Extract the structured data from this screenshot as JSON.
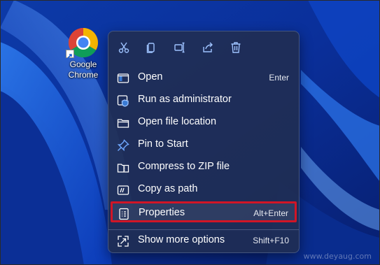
{
  "desktop": {
    "icon_label_line1": "Google",
    "icon_label_line2": "Chrome"
  },
  "toolbar": [
    {
      "name": "cut-icon"
    },
    {
      "name": "copy-icon"
    },
    {
      "name": "rename-icon"
    },
    {
      "name": "share-icon"
    },
    {
      "name": "delete-icon"
    }
  ],
  "menu": {
    "items": [
      {
        "label": "Open",
        "accelerator": "Enter",
        "icon": "open-icon"
      },
      {
        "label": "Run as administrator",
        "accelerator": "",
        "icon": "shield-icon"
      },
      {
        "label": "Open file location",
        "accelerator": "",
        "icon": "folder-icon"
      },
      {
        "label": "Pin to Start",
        "accelerator": "",
        "icon": "pin-icon"
      },
      {
        "label": "Compress to ZIP file",
        "accelerator": "",
        "icon": "zip-folder-icon"
      },
      {
        "label": "Copy as path",
        "accelerator": "",
        "icon": "copy-path-icon"
      },
      {
        "label": "Properties",
        "accelerator": "Alt+Enter",
        "icon": "properties-icon"
      },
      {
        "label": "Show more options",
        "accelerator": "Shift+F10",
        "icon": "more-options-icon"
      }
    ]
  },
  "colors": {
    "highlight_border": "#d11526",
    "menu_bg": "#202e52",
    "accent_blue": "#3a7bd5"
  },
  "watermark": "www.deyaug.com"
}
